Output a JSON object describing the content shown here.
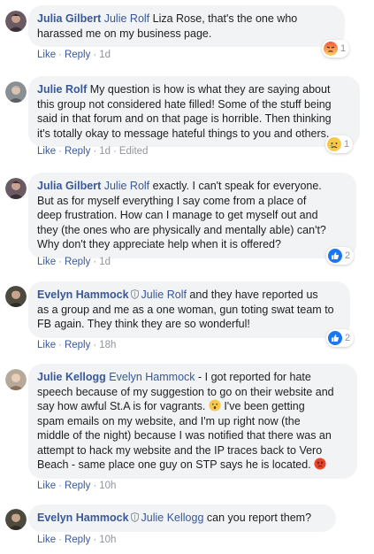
{
  "comments": [
    {
      "author": "Julia Gilbert",
      "mention": "Julie Rolf",
      "text": " Liza Rose, that's the one who harassed me on my business page.",
      "actions": {
        "like": "Like",
        "reply": "Reply",
        "time": "1d"
      },
      "reaction": {
        "icon": "angry-reaction-icon",
        "count": "1"
      }
    },
    {
      "author": "Julie Rolf",
      "text_lines": [
        " My question is how is what they are saying about",
        "this group not considered hate filled! Some of the stuff being",
        "said in that forum and on that page is horrible. Then thinking",
        "it's totally okay to message hateful things to you and others."
      ],
      "actions": {
        "like": "Like",
        "reply": "Reply",
        "time": "1d",
        "edited": "Edited"
      },
      "reaction": {
        "icon": "sad-reaction-icon",
        "count": "1"
      }
    },
    {
      "author": "Julia Gilbert",
      "mention": "Julie Rolf",
      "text_lines": [
        " exactly. I can't speak for everyone.",
        "But as for myself everything I say come from a place of",
        "deep frustration. How can I manage to get myself out and",
        "they (the ones who are physically and mentally able) can't?",
        "Why don't they appreciate help when it is offered?"
      ],
      "actions": {
        "like": "Like",
        "reply": "Reply",
        "time": "1d"
      },
      "reaction": {
        "icon": "like-reaction-icon",
        "count": "2"
      }
    },
    {
      "author": "Evelyn Hammock",
      "mention": "Julie Rolf",
      "text_lines": [
        " and they have reported us",
        "as a group and me as a one woman, gun toting swat team to",
        "FB again. They think they are so wonderful!"
      ],
      "actions": {
        "like": "Like",
        "reply": "Reply",
        "time": "18h"
      },
      "reaction": {
        "icon": "like-reaction-icon",
        "count": "2"
      }
    },
    {
      "author": "Julie Kellogg",
      "mention": "Evelyn Hammock",
      "text_lines": [
        " - I got reported for hate",
        "speech because of my suggestion to go on their website and",
        "say how awful St.A is for vagrants.",
        "spam emails on my website, and I'm up right now (the",
        "middle of the night) because I was notified that there was an",
        "attempt to hack my website and the IP traces back to Vero",
        "Beach - same place one guy on STP says he is located."
      ],
      "line3_tail": " I've been getting",
      "actions": {
        "like": "Like",
        "reply": "Reply",
        "time": "10h"
      }
    },
    {
      "author": "Evelyn Hammock",
      "mention": "Julie Kellogg",
      "text": " can you report them?",
      "actions": {
        "like": "Like",
        "reply": "Reply",
        "time": "10h"
      }
    }
  ],
  "colors": {
    "link": "#385898",
    "bubble": "#f2f3f5",
    "meta": "#90949c"
  }
}
